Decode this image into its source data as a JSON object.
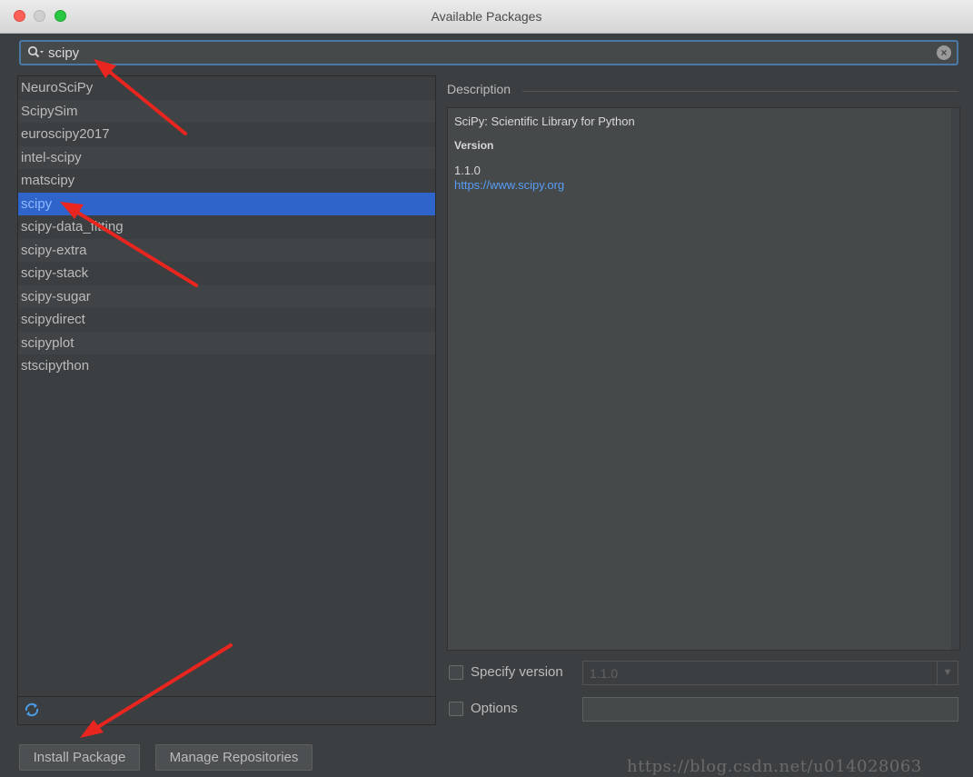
{
  "window": {
    "title": "Available Packages"
  },
  "search": {
    "value": "scipy"
  },
  "packages": [
    {
      "name": "NeuroSciPy"
    },
    {
      "name": "ScipySim"
    },
    {
      "name": "euroscipy2017"
    },
    {
      "name": "intel-scipy"
    },
    {
      "name": "matscipy"
    },
    {
      "name": "scipy",
      "selected": true
    },
    {
      "name": "scipy-data_fitting"
    },
    {
      "name": "scipy-extra"
    },
    {
      "name": "scipy-stack"
    },
    {
      "name": "scipy-sugar"
    },
    {
      "name": "scipydirect"
    },
    {
      "name": "scipyplot"
    },
    {
      "name": "stscipython"
    }
  ],
  "description": {
    "label": "Description",
    "title": "SciPy: Scientific Library for Python",
    "version_label": "Version",
    "version": "1.1.0",
    "link": "https://www.scipy.org"
  },
  "options": {
    "specify_version_label": "Specify version",
    "version_value": "1.1.0",
    "options_label": "Options"
  },
  "buttons": {
    "install": "Install Package",
    "manage": "Manage Repositories"
  },
  "watermark": "https://blog.csdn.net/u014028063",
  "colors": {
    "background": "#3c3f41",
    "selection": "#2f65ca",
    "link": "#589df6",
    "annotation_arrow": "#e8251f"
  }
}
